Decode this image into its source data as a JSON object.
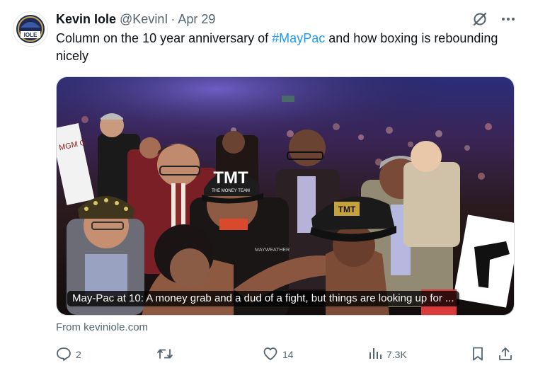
{
  "tweet": {
    "author_name": "Kevin Iole",
    "handle": "@KevinI",
    "separator": "·",
    "timestamp": "Apr 29",
    "text_before": "Column on the 10 year anniversary of ",
    "hashtag": "#MayPac",
    "text_after": " and how boxing is rebounding nicely"
  },
  "avatar": {
    "text": "IOLE"
  },
  "card": {
    "caption": "May-Pac at 10: A money grab and a dud of a fight, but things are looking up for ...",
    "source": "From keviniole.com",
    "image_text": {
      "hat_logo": "TMT",
      "hat_sub": "THE MONEY TEAM",
      "shirt": "MAYWEATHER",
      "banner": "MGM G",
      "cap_logo": "TMT"
    }
  },
  "actions": {
    "replies": "2",
    "reposts": "",
    "likes": "14",
    "views": "7.3K"
  },
  "colors": {
    "accent": "#1d9bf0",
    "muted": "#536471",
    "text": "#0f1419"
  },
  "icons": [
    "grok-icon",
    "more-icon",
    "reply-icon",
    "repost-icon",
    "like-icon",
    "views-icon",
    "bookmark-icon",
    "share-icon"
  ]
}
